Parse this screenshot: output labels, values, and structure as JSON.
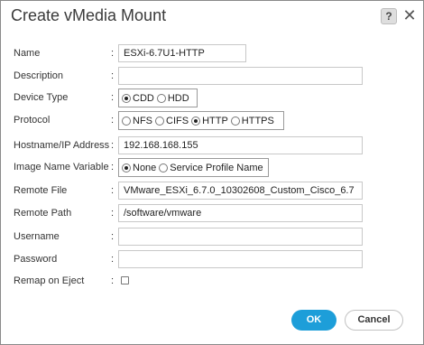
{
  "dialog": {
    "title": "Create vMedia Mount",
    "help_label": "?",
    "close_label": "✕"
  },
  "form": {
    "colon": ":",
    "name": {
      "label": "Name",
      "value": "ESXi-6.7U1-HTTP"
    },
    "description": {
      "label": "Description",
      "value": ""
    },
    "device_type": {
      "label": "Device Type",
      "options": [
        "CDD",
        "HDD"
      ],
      "selected": "CDD"
    },
    "protocol": {
      "label": "Protocol",
      "options": [
        "NFS",
        "CIFS",
        "HTTP",
        "HTTPS"
      ],
      "selected": "HTTP"
    },
    "hostname": {
      "label": "Hostname/IP Address",
      "value": "192.168.168.155"
    },
    "image_name_variable": {
      "label": "Image Name Variable",
      "options": [
        "None",
        "Service Profile Name"
      ],
      "selected": "None"
    },
    "remote_file": {
      "label": "Remote File",
      "value": "VMware_ESXi_6.7.0_10302608_Custom_Cisco_6.7"
    },
    "remote_path": {
      "label": "Remote Path",
      "value": "/software/vmware"
    },
    "username": {
      "label": "Username",
      "value": ""
    },
    "password": {
      "label": "Password",
      "value": ""
    },
    "remap_on_eject": {
      "label": "Remap on Eject",
      "checked": false
    }
  },
  "buttons": {
    "ok": "OK",
    "cancel": "Cancel"
  }
}
